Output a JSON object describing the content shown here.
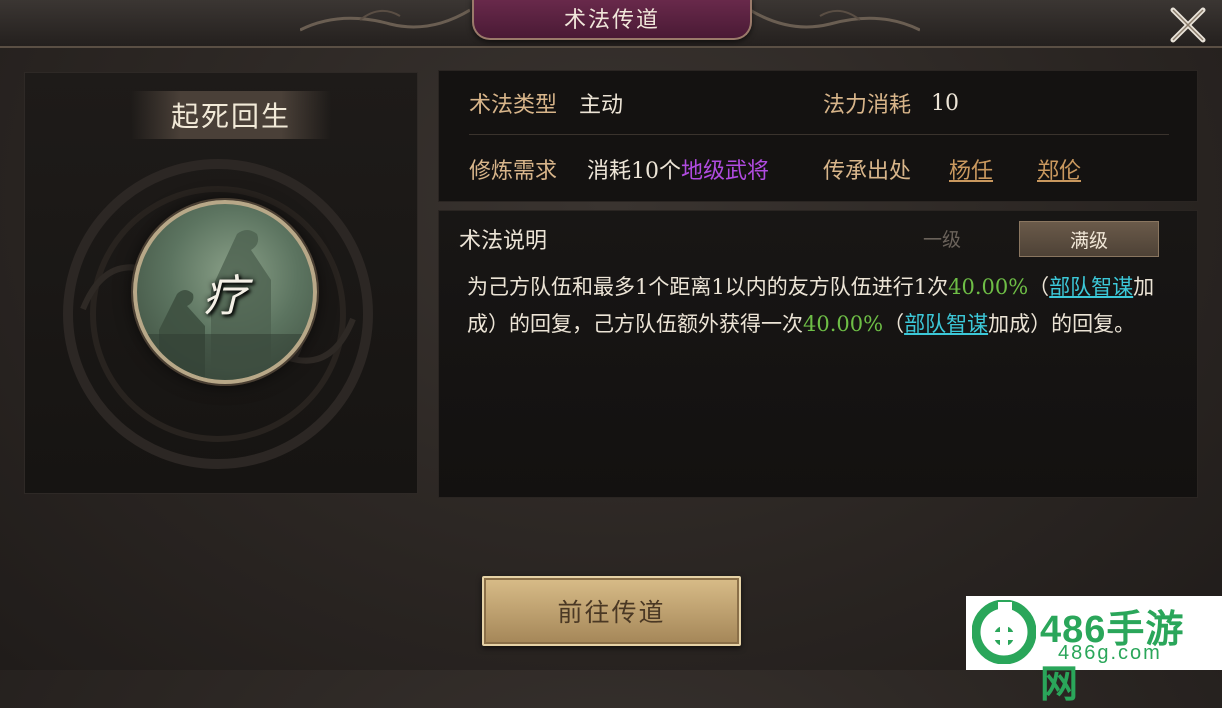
{
  "header": {
    "title": "术法传道"
  },
  "skill": {
    "name": "起死回生",
    "glyph": "疗"
  },
  "info": {
    "type_label": "术法类型",
    "type_value": "主动",
    "cost_label": "法力消耗",
    "cost_value": "10",
    "require_label": "修炼需求",
    "require_prefix": "消耗10个",
    "require_highlight": "地级武将",
    "source_label": "传承出处",
    "sources": [
      "杨任",
      "郑伦"
    ]
  },
  "description": {
    "title": "术法说明",
    "tabs": [
      "一级",
      "满级"
    ],
    "selected_tab": "满级",
    "seg1": "为己方队伍和最多1个距离1以内的友方队伍进行1次",
    "pct1": "40.00%",
    "seg2": "（",
    "link1": "部队智谋",
    "seg3": "加成）的回复，己方队伍额外获得一次",
    "pct2": "40.00%",
    "seg4": "（",
    "link2": "部队智谋",
    "seg5": "加成）的回复。"
  },
  "actions": {
    "go_label": "前往传道"
  },
  "watermark": {
    "main": "486手游网",
    "sub": "486g.com"
  },
  "colors": {
    "accent_gold": "#d8b58a",
    "purple": "#b04be0",
    "green": "#6ebe46",
    "cyan": "#3cc8d8"
  }
}
